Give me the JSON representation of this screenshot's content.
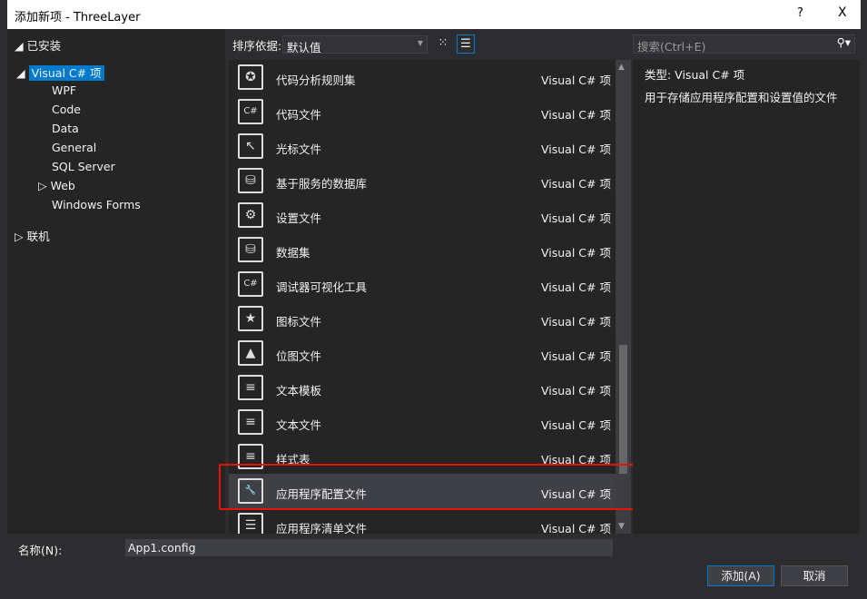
{
  "title": "添加新项 - ThreeLayer",
  "help": "?",
  "close": "X",
  "left": {
    "header": "已安装",
    "items": [
      "Visual C# 项",
      "WPF",
      "Code",
      "Data",
      "General",
      "SQL Server",
      "Web",
      "Windows Forms"
    ],
    "online": "联机"
  },
  "toolbar": {
    "sort_label": "排序依据:",
    "sort_value": "默认值",
    "search_placeholder": "搜索(Ctrl+E)"
  },
  "items": [
    {
      "label": "代码分析规则集",
      "type": "Visual C# 项",
      "icon": "ruleset-icon"
    },
    {
      "label": "代码文件",
      "type": "Visual C# 项",
      "icon": "code-file-icon"
    },
    {
      "label": "光标文件",
      "type": "Visual C# 项",
      "icon": "cursor-file-icon"
    },
    {
      "label": "基于服务的数据库",
      "type": "Visual C# 项",
      "icon": "database-icon"
    },
    {
      "label": "设置文件",
      "type": "Visual C# 项",
      "icon": "settings-gear-icon"
    },
    {
      "label": "数据集",
      "type": "Visual C# 项",
      "icon": "dataset-icon"
    },
    {
      "label": "调试器可视化工具",
      "type": "Visual C# 项",
      "icon": "visualizer-icon"
    },
    {
      "label": "图标文件",
      "type": "Visual C# 项",
      "icon": "icon-file-icon"
    },
    {
      "label": "位图文件",
      "type": "Visual C# 项",
      "icon": "bitmap-icon"
    },
    {
      "label": "文本模板",
      "type": "Visual C# 项",
      "icon": "text-template-icon"
    },
    {
      "label": "文本文件",
      "type": "Visual C# 项",
      "icon": "text-file-icon"
    },
    {
      "label": "样式表",
      "type": "Visual C# 项",
      "icon": "stylesheet-icon"
    },
    {
      "label": "应用程序配置文件",
      "type": "Visual C# 项",
      "icon": "config-file-icon"
    },
    {
      "label": "应用程序清单文件",
      "type": "Visual C# 项",
      "icon": "manifest-icon"
    }
  ],
  "selected_index": 12,
  "details": {
    "type": "类型:  Visual C# 项",
    "description": "用于存储应用程序配置和设置值的文件"
  },
  "name": {
    "label": "名称(N):",
    "value": "App1.config"
  },
  "buttons": {
    "add": "添加(A)",
    "cancel": "取消"
  },
  "colors": {
    "accent": "#007acc",
    "highlight": "#e51400"
  }
}
